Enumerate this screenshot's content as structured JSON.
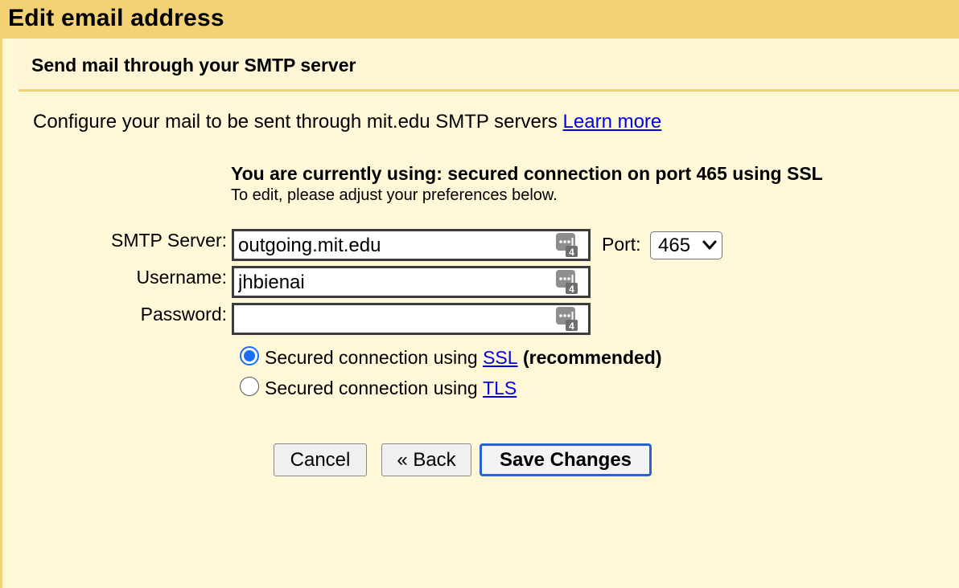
{
  "header": {
    "title": "Edit email address"
  },
  "section": {
    "heading": "Send mail through your SMTP server"
  },
  "intro": {
    "text": "Configure your mail to be sent through mit.edu SMTP servers",
    "learn_more": "Learn more"
  },
  "status": {
    "current": "You are currently using: secured connection on port 465 using SSL",
    "hint": "To edit, please adjust your preferences below."
  },
  "form": {
    "smtp_label": "SMTP Server:",
    "smtp_value": "outgoing.mit.edu",
    "username_label": "Username:",
    "username_value": "jhbienai",
    "password_label": "Password:",
    "password_value": "",
    "port_label": "Port:",
    "port_value": "465",
    "field_icon": "password-manager-icon",
    "field_icon_badge": "4"
  },
  "security": {
    "ssl_prefix": "Secured connection using",
    "ssl_link": "SSL",
    "ssl_suffix": "(recommended)",
    "ssl_selected": true,
    "tls_prefix": "Secured connection using",
    "tls_link": "TLS",
    "tls_selected": false
  },
  "buttons": {
    "cancel": "Cancel",
    "back": "« Back",
    "save": "Save Changes"
  },
  "colors": {
    "title_bar": "#f2d274",
    "panel_bg": "#fef7d8",
    "link": "#0000ee",
    "radio_accent": "#1b6ef3",
    "primary_button_border": "#2a62d6"
  }
}
